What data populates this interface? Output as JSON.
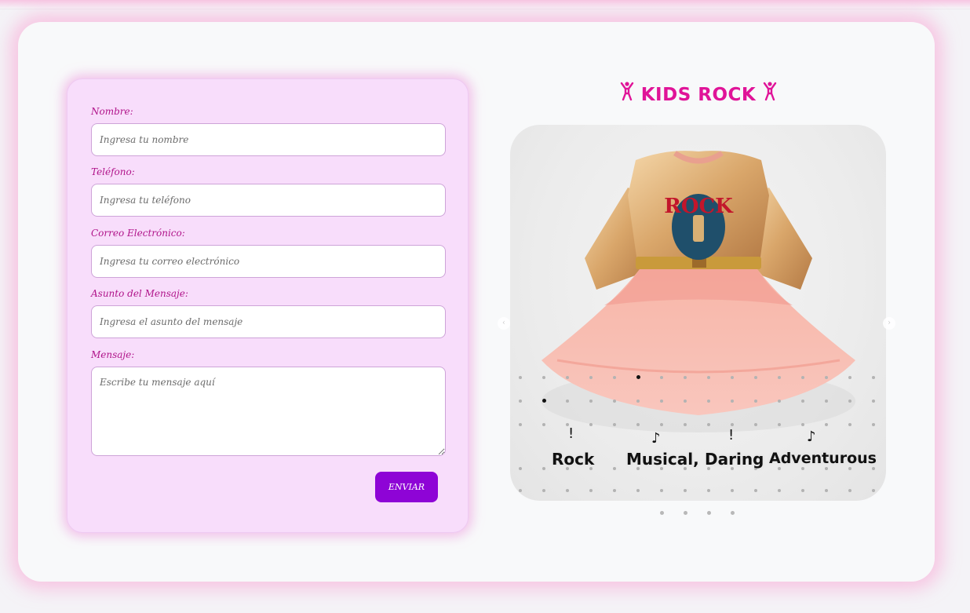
{
  "form": {
    "fields": [
      {
        "label": "Nombre:",
        "placeholder": "Ingresa tu nombre"
      },
      {
        "label": "Teléfono:",
        "placeholder": "Ingresa tu teléfono"
      },
      {
        "label": "Correo Electrónico:",
        "placeholder": "Ingresa tu correo electrónico"
      },
      {
        "label": "Asunto del Mensaje:",
        "placeholder": "Ingresa el asunto del mensaje"
      }
    ],
    "message": {
      "label": "Mensaje:",
      "placeholder": "Escribe tu mensaje aquí"
    },
    "submit_label": "ENVIAR"
  },
  "gallery": {
    "title": "KIDS ROCK",
    "title_icon": "person-raising-arms-icon",
    "tags": [
      "Rock",
      "Musical,",
      "Daring",
      "Adventurous"
    ],
    "tag_icons": [
      "exclamation-icon",
      "music-note-icon",
      "exclamation-icon",
      "music-note-icon"
    ],
    "shirt_text": "ROCK",
    "slide_count": 4,
    "active_slide": 1
  },
  "colors": {
    "accent": "#e01498",
    "label": "#b0148a",
    "button": "#8e04d6",
    "form_bg": "#f8ddfb"
  }
}
